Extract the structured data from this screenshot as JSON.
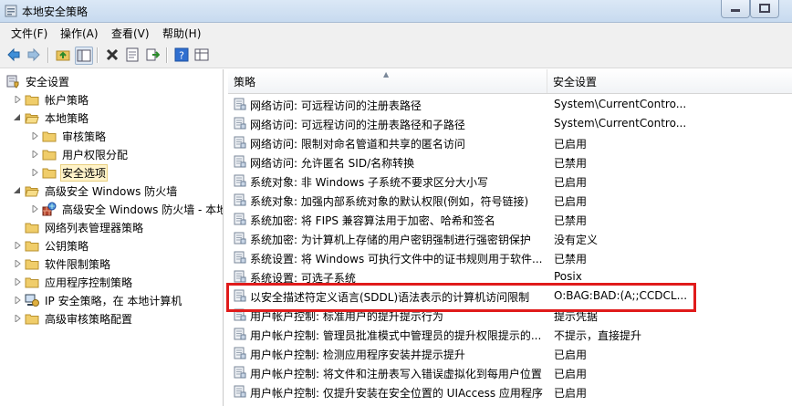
{
  "window": {
    "title": "本地安全策略"
  },
  "menu": [
    "文件(F)",
    "操作(A)",
    "查看(V)",
    "帮助(H)"
  ],
  "tree": [
    {
      "label": "安全设置"
    },
    {
      "label": "帐户策略"
    },
    {
      "label": "本地策略"
    },
    {
      "label": "审核策略"
    },
    {
      "label": "用户权限分配"
    },
    {
      "label": "安全选项"
    },
    {
      "label": "高级安全 Windows 防火墙"
    },
    {
      "label": "高级安全 Windows 防火墙 - 本地"
    },
    {
      "label": "网络列表管理器策略"
    },
    {
      "label": "公钥策略"
    },
    {
      "label": "软件限制策略"
    },
    {
      "label": "应用程序控制策略"
    },
    {
      "label": "IP 安全策略，在 本地计算机"
    },
    {
      "label": "高级审核策略配置"
    }
  ],
  "columns": {
    "policy": "策略",
    "setting": "安全设置"
  },
  "rows": [
    {
      "policy": "网络访问: 可远程访问的注册表路径",
      "setting": "System\\CurrentContro..."
    },
    {
      "policy": "网络访问: 可远程访问的注册表路径和子路径",
      "setting": "System\\CurrentContro..."
    },
    {
      "policy": "网络访问: 限制对命名管道和共享的匿名访问",
      "setting": "已启用"
    },
    {
      "policy": "网络访问: 允许匿名 SID/名称转换",
      "setting": "已禁用"
    },
    {
      "policy": "系统对象: 非 Windows 子系统不要求区分大小写",
      "setting": "已启用"
    },
    {
      "policy": "系统对象: 加强内部系统对象的默认权限(例如，符号链接)",
      "setting": "已启用"
    },
    {
      "policy": "系统加密: 将 FIPS 兼容算法用于加密、哈希和签名",
      "setting": "已禁用"
    },
    {
      "policy": "系统加密: 为计算机上存储的用户密钥强制进行强密钥保护",
      "setting": "没有定义"
    },
    {
      "policy": "系统设置: 将 Windows 可执行文件中的证书规则用于软件...",
      "setting": "已禁用"
    },
    {
      "policy": "系统设置: 可选子系统",
      "setting": "Posix"
    },
    {
      "policy": "以安全描述符定义语言(SDDL)语法表示的计算机访问限制",
      "setting": "O:BAG:BAD:(A;;CCDCL..."
    },
    {
      "policy": "用户帐户控制: 标准用户的提升提示行为",
      "setting": "提示凭据"
    },
    {
      "policy": "用户帐户控制: 管理员批准模式中管理员的提升权限提示的...",
      "setting": "不提示，直接提升"
    },
    {
      "policy": "用户帐户控制: 检测应用程序安装并提示提升",
      "setting": "已启用"
    },
    {
      "policy": "用户帐户控制: 将文件和注册表写入错误虚拟化到每用户位置",
      "setting": "已启用"
    },
    {
      "policy": "用户帐户控制: 仅提升安装在安全位置的 UIAccess 应用程序",
      "setting": "已启用"
    }
  ]
}
